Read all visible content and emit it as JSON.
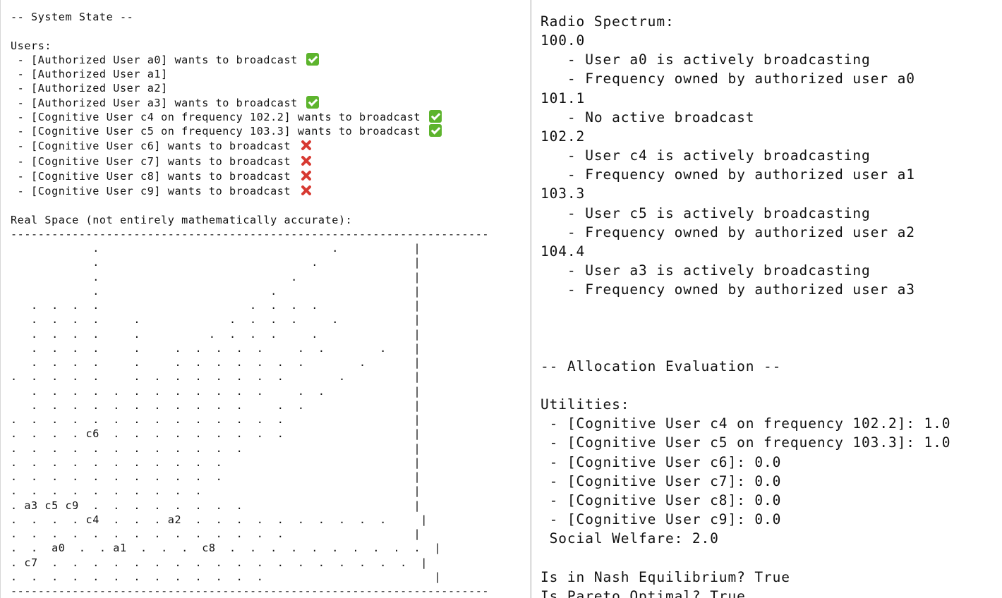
{
  "left": {
    "system_state_title": "-- System State --",
    "users_heading": "Users:",
    "users": [
      {
        "text": " - [Authorized User a0] wants to broadcast",
        "status_icon": "check-icon"
      },
      {
        "text": " - [Authorized User a1]",
        "status_icon": ""
      },
      {
        "text": " - [Authorized User a2]",
        "status_icon": ""
      },
      {
        "text": " - [Authorized User a3] wants to broadcast",
        "status_icon": "check-icon"
      },
      {
        "text": " - [Cognitive User c4 on frequency 102.2] wants to broadcast",
        "status_icon": "check-icon"
      },
      {
        "text": " - [Cognitive User c5 on frequency 103.3] wants to broadcast",
        "status_icon": "check-icon"
      },
      {
        "text": " - [Cognitive User c6] wants to broadcast",
        "status_icon": "cross-icon"
      },
      {
        "text": " - [Cognitive User c7] wants to broadcast",
        "status_icon": "cross-icon"
      },
      {
        "text": " - [Cognitive User c8] wants to broadcast",
        "status_icon": "cross-icon"
      },
      {
        "text": " - [Cognitive User c9] wants to broadcast",
        "status_icon": "cross-icon"
      }
    ],
    "real_space_heading": "Real Space (not entirely mathematically accurate):",
    "real_space_grid": "----------------------------------------------------------------------\n            .                                  .           |\n            .                               .              |\n            .                            .                 |\n            .                         .                    |\n   .  .  .  .                      .  .  .  .              |\n   .  .  .  .     .             .  .  .  .     .           |\n   .  .  .  .     .          .  .  .  .     .              |\n   .  .  .  .     .     .  .  .  .  .     .  .        .    |\n   .  .  .  .     .     .  .  .  .  .  .  .        .       |\n.  .  .  .  .     .  .  .  .  .  .  .  .        .          |\n   .  .  .  .  .  .  .  .  .  .  .  .     .  .             |\n   .  .  .  .  .  .  .  .  .  .  .     .  .                |\n.  .  .  .  .  .  .  .  .  .  .  .  .  .                   |\n.  .  .  . c6  .  .  .  .  .  .  .  .  .                   |\n.  .  .  .  .  .  .  .  .  .  .  .                         |\n.  .  .  .  .  .  .  .  .  .  .                            |\n.  .  .  .  .  .  .  .  .  .  .                            |\n.  .  .  .  .  .  .  .  .  .                               |\n. a3 c5 c9  .  .  .  .  .  .  .  .                         |\n.  .  .  . c4  .  .  . a2  .  .  .  .  .  .  .  .  .  .     |\n.  .  .  .  .  .  .  .  .  .  .  .  .  .                   |\n.  .  a0  .  . a1  .  .  .  c8  .  .  .  .  .  .  .  .  .  .  |\n. c7  .  .  .  .  .  .  .  .  .  .  .  .  .  .  .  .  .  .  |\n.  .  .  .  .  .  .  .  .  .  .  .  .                         |\n----------------------------------------------------------------------"
  },
  "right": {
    "radio_spectrum_heading": "Radio Spectrum:",
    "frequencies": [
      {
        "freq": "100.0",
        "lines": [
          "   - User a0 is actively broadcasting",
          "   - Frequency owned by authorized user a0"
        ]
      },
      {
        "freq": "101.1",
        "lines": [
          "   - No active broadcast"
        ]
      },
      {
        "freq": "102.2",
        "lines": [
          "   - User c4 is actively broadcasting",
          "   - Frequency owned by authorized user a1"
        ]
      },
      {
        "freq": "103.3",
        "lines": [
          "   - User c5 is actively broadcasting",
          "   - Frequency owned by authorized user a2"
        ]
      },
      {
        "freq": "104.4",
        "lines": [
          "   - User a3 is actively broadcasting",
          "   - Frequency owned by authorized user a3"
        ]
      }
    ],
    "allocation_title": "-- Allocation Evaluation --",
    "utilities_heading": "Utilities:",
    "utilities": [
      " - [Cognitive User c4 on frequency 102.2]: 1.0",
      " - [Cognitive User c5 on frequency 103.3]: 1.0",
      " - [Cognitive User c6]: 0.0",
      " - [Cognitive User c7]: 0.0",
      " - [Cognitive User c8]: 0.0",
      " - [Cognitive User c9]: 0.0"
    ],
    "social_welfare": " Social Welfare: 2.0",
    "nash_equilibrium": "Is in Nash Equilibrium? True",
    "pareto_optimal": "Is Pareto Optimal? True"
  }
}
